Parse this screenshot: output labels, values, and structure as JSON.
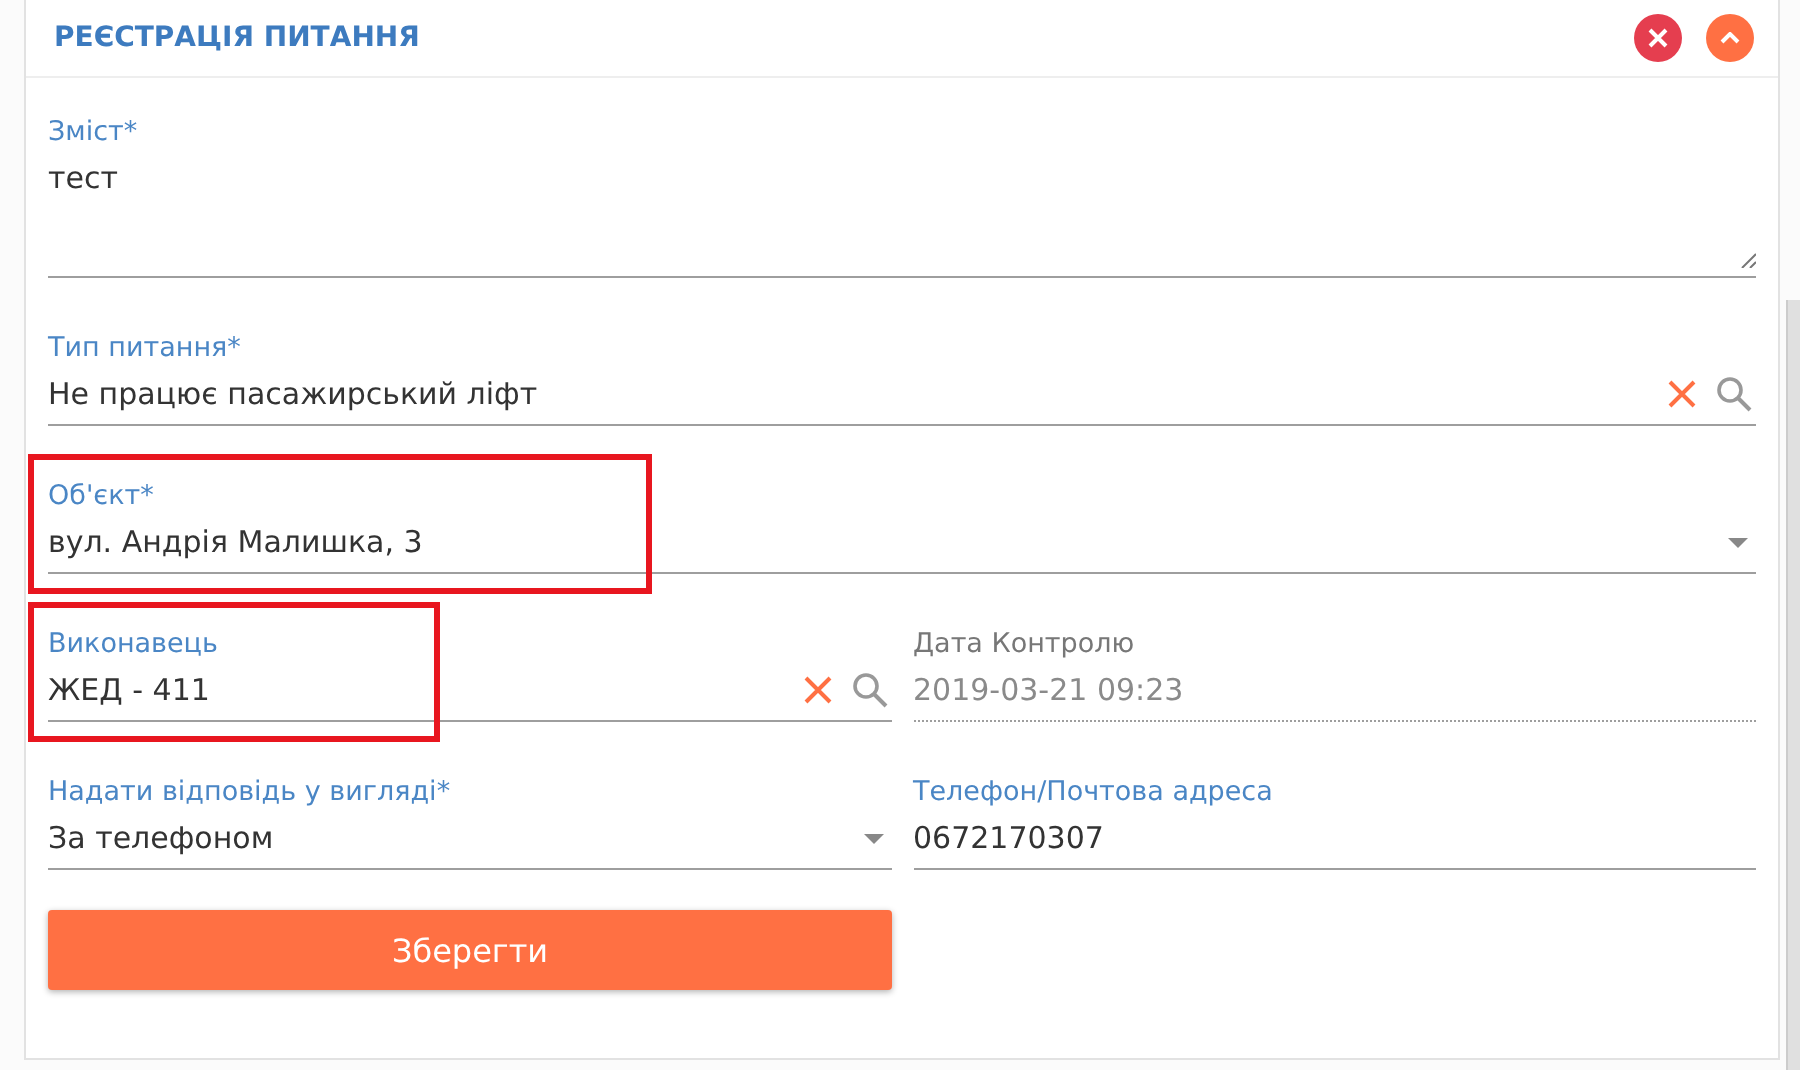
{
  "panel": {
    "title": "РЕЄСТРАЦІЯ ПИТАННЯ",
    "header_buttons": [
      {
        "kind": "close"
      },
      {
        "kind": "collapse"
      }
    ]
  },
  "rows": [
    [
      {
        "kind": "textarea",
        "label": "Зміст*",
        "value": "тест",
        "disabled": false,
        "highlighted": false
      }
    ],
    [
      {
        "kind": "lookup",
        "label": "Тип питання*",
        "value": "Не працює пасажирський ліфт",
        "disabled": false,
        "highlighted": false
      }
    ],
    [
      {
        "kind": "select",
        "label": "Об'єкт*",
        "value": "вул. Андрія Малишка, 3",
        "disabled": false,
        "highlighted": true
      }
    ],
    [
      {
        "kind": "lookup",
        "label": "Виконавець",
        "value": "ЖЕД - 411",
        "disabled": false,
        "highlighted": true
      },
      {
        "kind": "text",
        "label": "Дата Контролю",
        "value": "2019-03-21 09:23",
        "disabled": true,
        "highlighted": false
      }
    ],
    [
      {
        "kind": "select",
        "label": "Надати відповідь у вигляді*",
        "value": "За телефоном",
        "disabled": false,
        "highlighted": false
      },
      {
        "kind": "text",
        "label": "Телефон/Почтова адреса",
        "value": "0672170307",
        "disabled": false,
        "highlighted": false
      }
    ]
  ],
  "save_button": {
    "label": "Зберегти"
  }
}
